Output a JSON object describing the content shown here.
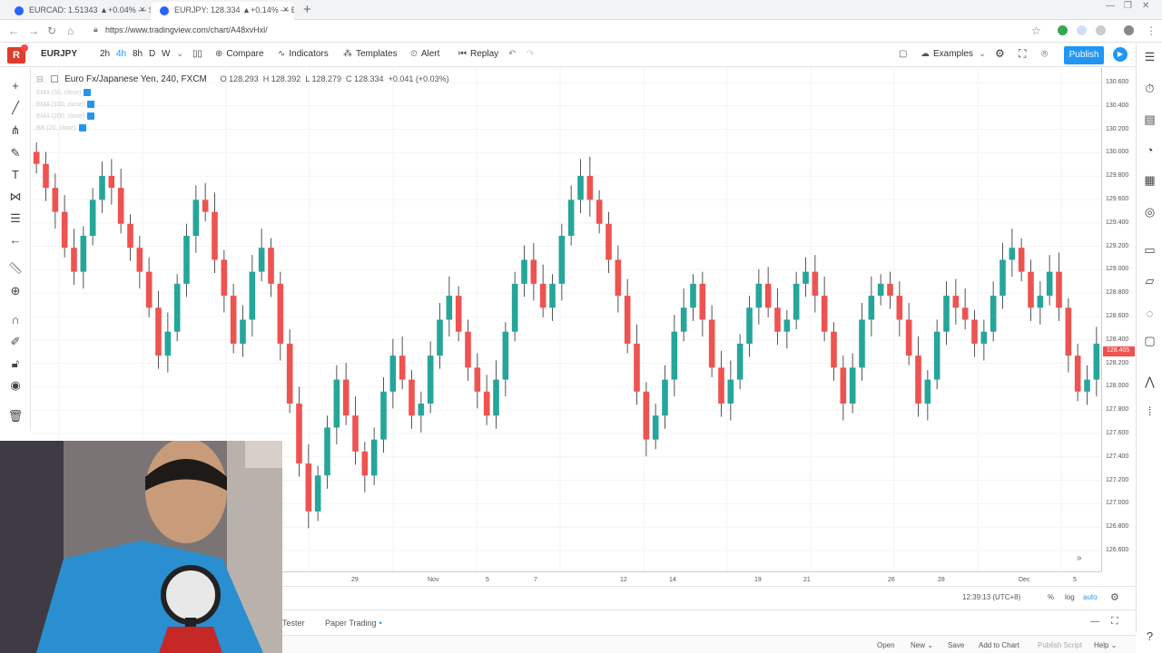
{
  "browser": {
    "tabs": [
      {
        "label": "EURCAD: 1.51343 ▲+0.04% — S",
        "active": false
      },
      {
        "label": "EURJPY: 128.334 ▲+0.14% — E",
        "active": true
      }
    ],
    "url": "https://www.tradingview.com/chart/A48xvHxl/"
  },
  "toolbar": {
    "logo": "R",
    "symbol": "EURJPY",
    "intervals": [
      "2h",
      "4h",
      "8h",
      "D",
      "W"
    ],
    "compare": "Compare",
    "indicators": "Indicators",
    "templates": "Templates",
    "alert": "Alert",
    "replay": "Replay",
    "examples": "Examples",
    "publish": "Publish"
  },
  "legend": {
    "title": "Euro Fx/Japanese Yen, 240, FXCM",
    "open": "O 128.293",
    "high": "H 128.392",
    "low": "L 128.279",
    "close": "C 128.334",
    "change": "+0.041 (+0.03%)",
    "indicators": [
      "EMA (50, close)",
      "EMA (100, close)",
      "EMA (200, close)",
      "BB (20, close)"
    ]
  },
  "price_axis": {
    "ticks": [
      "130.600",
      "130.400",
      "130.200",
      "130.000",
      "129.800",
      "129.600",
      "129.400",
      "129.200",
      "129.000",
      "128.800",
      "128.600",
      "128.400",
      "128.200",
      "128.000",
      "127.800",
      "127.600",
      "127.400",
      "127.200",
      "127.000",
      "126.800",
      "126.600"
    ],
    "current": "128.405"
  },
  "time_axis": {
    "ticks": [
      "29",
      "Nov",
      "5",
      "7",
      "12",
      "14",
      "19",
      "21",
      "26",
      "28",
      "Dec",
      "5"
    ]
  },
  "bottom": {
    "clock": "12:39:13 (UTC+8)",
    "percent": "%",
    "log": "log",
    "auto": "auto",
    "tester": "Tester",
    "paper_trading": "Paper Trading",
    "open": "Open",
    "new": "New",
    "save": "Save",
    "add_to_chart": "Add to Chart",
    "publish_script": "Publish Script",
    "help": "Help"
  },
  "colors": {
    "up": "#26a69a",
    "down": "#ef5350",
    "accent": "#2196f3"
  },
  "chart_data": {
    "type": "candlestick",
    "symbol": "EURJPY",
    "interval": "240",
    "ylim": [
      126.5,
      130.7
    ],
    "x_ticks": [
      "29",
      "Nov",
      "5",
      "7",
      "12",
      "14",
      "19",
      "21",
      "26",
      "28",
      "Dec",
      "5"
    ],
    "close": [
      129.9,
      129.7,
      129.5,
      129.2,
      129.0,
      129.3,
      129.6,
      129.8,
      129.7,
      129.4,
      129.2,
      129.0,
      128.7,
      128.3,
      128.5,
      128.9,
      129.3,
      129.6,
      129.5,
      129.1,
      128.8,
      128.4,
      128.6,
      129.0,
      129.2,
      128.9,
      128.4,
      127.9,
      127.4,
      127.0,
      127.3,
      127.7,
      128.1,
      127.8,
      127.5,
      127.3,
      127.6,
      128.0,
      128.3,
      128.1,
      127.8,
      127.9,
      128.3,
      128.6,
      128.8,
      128.5,
      128.2,
      128.0,
      127.8,
      128.1,
      128.5,
      128.9,
      129.1,
      128.9,
      128.7,
      128.9,
      129.3,
      129.6,
      129.8,
      129.6,
      129.4,
      129.1,
      128.8,
      128.4,
      128.0,
      127.6,
      127.8,
      128.1,
      128.5,
      128.7,
      128.9,
      128.6,
      128.2,
      127.9,
      128.1,
      128.4,
      128.7,
      128.9,
      128.7,
      128.5,
      128.6,
      128.9,
      129.0,
      128.8,
      128.5,
      128.2,
      127.9,
      128.2,
      128.6,
      128.8,
      128.9,
      128.8,
      128.6,
      128.3,
      127.9,
      128.1,
      128.5,
      128.8,
      128.7,
      128.6,
      128.4,
      128.5,
      128.8,
      129.1,
      129.2,
      129.0,
      128.7,
      128.8,
      129.0,
      128.7,
      128.3,
      128.0,
      128.1,
      128.4
    ]
  }
}
